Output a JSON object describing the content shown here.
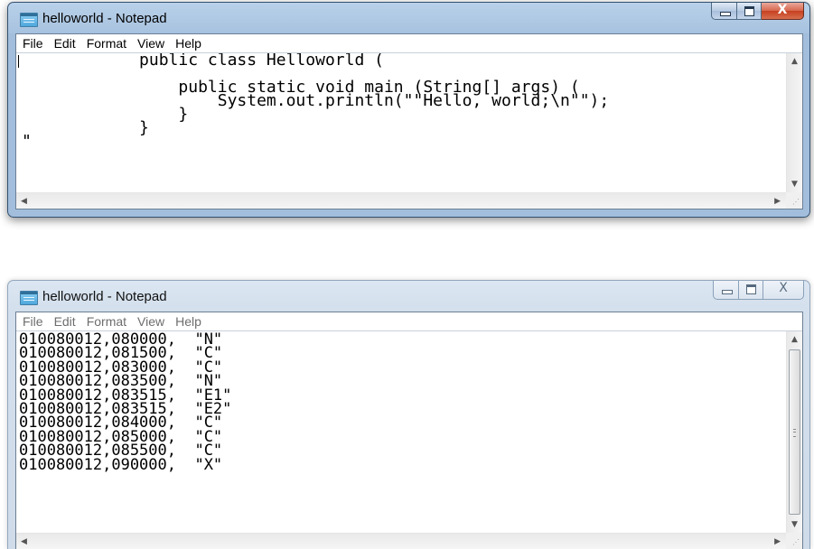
{
  "windows": [
    {
      "title": "helloworld - Notepad",
      "menu": [
        "File",
        "Edit",
        "Format",
        "View",
        "Help"
      ],
      "lines": [
        "            public class Helloworld (",
        "",
        "                public static void main (String[] args) (",
        "                    System.out.println(\"\"Hello, world;\\n\"\");",
        "                }",
        "            }",
        "\""
      ],
      "close_glyph": "X"
    },
    {
      "title": "helloworld - Notepad",
      "menu": [
        "File",
        "Edit",
        "Format",
        "View",
        "Help"
      ],
      "lines": [
        "010080012,080000,  \"N\"",
        "010080012,081500,  \"C\"",
        "010080012,083000,  \"C\"",
        "010080012,083500,  \"N\"",
        "010080012,083515,  \"E1\"",
        "010080012,083515,  \"E2\"",
        "010080012,084000,  \"C\"",
        "010080012,085000,  \"C\"",
        "010080012,085500,  \"C\"",
        "010080012,090000,  \"X\""
      ],
      "close_glyph": "X"
    }
  ]
}
